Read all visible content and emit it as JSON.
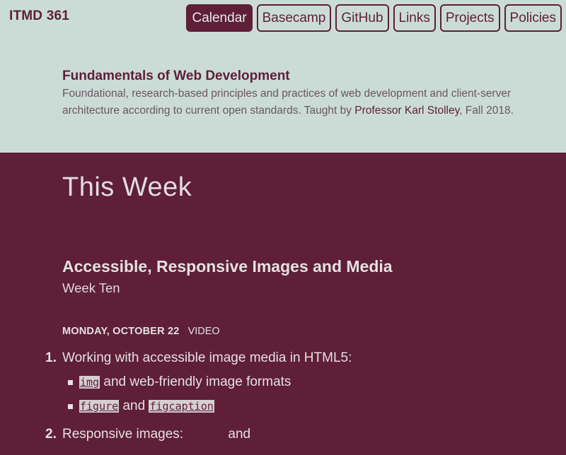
{
  "header": {
    "brand": "ITMD 361",
    "nav": [
      "Calendar",
      "Basecamp",
      "GitHub",
      "Links",
      "Projects",
      "Policies"
    ],
    "active_nav": "Calendar"
  },
  "course": {
    "title": "Fundamentals of Web Development",
    "desc_part1": "Foundational, research-based principles and practices of web development and client-server architecture according to current open standards. Taught by ",
    "professor": "Professor Karl Stolley",
    "desc_part2": ", Fall 2018."
  },
  "main": {
    "week_heading": "This Week",
    "unit_title": "Accessible, Responsive Images and Media",
    "unit_subtitle": "Week Ten",
    "day_label": "Monday, October 22",
    "day_tag": "Video",
    "agenda": {
      "item1": {
        "number": "1.",
        "text": "Working with accessible image media in HTML5:",
        "sub1_code": "img",
        "sub1_text": " and web-friendly image formats",
        "sub2_code1": "figure",
        "sub2_text": " and ",
        "sub2_code2": "figcaption"
      },
      "item2": {
        "number": "2.",
        "text": "Responsive images:",
        "text_after": "and"
      }
    }
  },
  "colors": {
    "maroon": "#5e1f37",
    "mint": "#cbdcd7",
    "light_text": "#e6e0e2"
  }
}
